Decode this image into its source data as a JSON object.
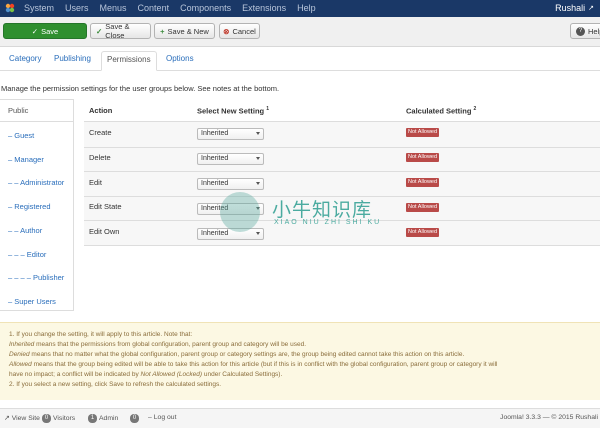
{
  "topbar": {
    "menu": [
      "System",
      "Users",
      "Menus",
      "Content",
      "Components",
      "Extensions",
      "Help"
    ],
    "user": "Rushali"
  },
  "toolbar": {
    "save": "Save",
    "save_close": "Save & Close",
    "save_new": "Save & New",
    "cancel": "Cancel",
    "help": "Help"
  },
  "tabs": [
    "Category",
    "Publishing",
    "Permissions",
    "Options"
  ],
  "active_tab": "Permissions",
  "manage_text": "Manage the permission settings for the user groups below. See notes at the bottom.",
  "groups": [
    "Public",
    "– Guest",
    "– Manager",
    "– – Administrator",
    "– Registered",
    "– – Author",
    "– – – Editor",
    "– – – – Publisher",
    "– Super Users"
  ],
  "table": {
    "col_action": "Action",
    "col_select": "Select New Setting",
    "col_select_note": "1",
    "col_calc": "Calculated Setting",
    "col_calc_note": "2",
    "rows": [
      {
        "action": "Create",
        "setting": "Inherited",
        "calculated": "Not Allowed"
      },
      {
        "action": "Delete",
        "setting": "Inherited",
        "calculated": "Not Allowed"
      },
      {
        "action": "Edit",
        "setting": "Inherited",
        "calculated": "Not Allowed"
      },
      {
        "action": "Edit State",
        "setting": "Inherited",
        "calculated": "Not Allowed"
      },
      {
        "action": "Edit Own",
        "setting": "Inherited",
        "calculated": "Not Allowed"
      }
    ]
  },
  "watermark": {
    "chinese": "小牛知识库",
    "pinyin": "XIAO NIU ZHI SHI KU"
  },
  "notes": {
    "line1": "1. If you change the setting, it will apply to this article. Note that:",
    "inherited_term": "Inherited",
    "inherited_text": " means that the permissions from global configuration, parent group and category will be used.",
    "denied_term": "Denied",
    "denied_text": " means that no matter what the global configuration, parent group or category settings are, the group being edited cannot take this action on this article.",
    "allowed_term": "Allowed",
    "allowed_text": " means that the group being edited will be able to take this action for this article (but if this is in conflict with the global configuration, parent group or category it will",
    "allowed_text2a": "have no impact; a conflict will be indicated by ",
    "allowed_term2": "Not Allowed (Locked)",
    "allowed_text2b": " under Calculated Settings).",
    "line2": "2. If you select a new setting, click Save to refresh the calculated settings."
  },
  "status": {
    "view_site": "View Site",
    "visitors_count": "0",
    "visitors": "Visitors",
    "admin_count": "1",
    "admin": "Admin",
    "messages_count": "0",
    "logout": "Log out",
    "version": "Joomla! 3.3.3 — © 2015 Rushali"
  },
  "colors": {
    "navbar": "#1a3867",
    "save_green": "#2f8f2f",
    "badge_red": "#b94a48",
    "link_blue": "#2a6ebb",
    "notes_bg": "#fcf8e3"
  }
}
